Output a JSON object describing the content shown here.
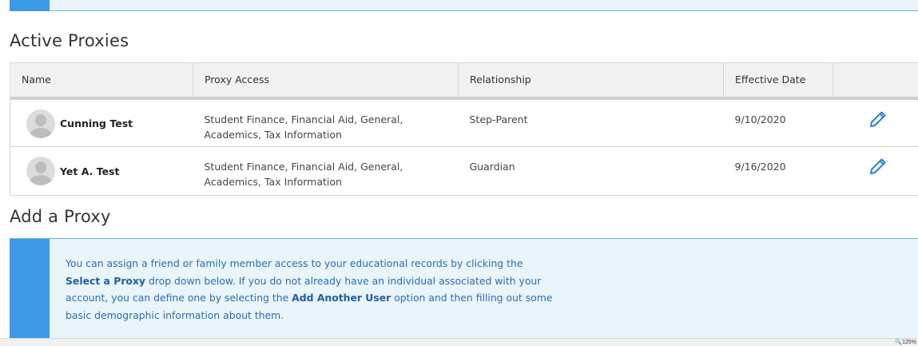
{
  "colors": {
    "accent": "#3d9ae6",
    "info_bg": "#e9f4fb",
    "info_text": "#2a6fae",
    "edit_icon": "#2b7fe0"
  },
  "active_proxies": {
    "title": "Active Proxies",
    "columns": [
      "Name",
      "Proxy Access",
      "Relationship",
      "Effective Date",
      ""
    ],
    "rows": [
      {
        "name": "Cunning Test",
        "access_line1": "Student Finance, Financial Aid, General,",
        "access_line2": "Academics, Tax Information",
        "relationship": "Step-Parent",
        "effective_date": "9/10/2020",
        "avatar_icon": "user-avatar-icon",
        "edit_icon": "pencil-icon"
      },
      {
        "name": "Yet A. Test",
        "access_line1": "Student Finance, Financial Aid, General,",
        "access_line2": "Academics, Tax Information",
        "relationship": "Guardian",
        "effective_date": "9/16/2020",
        "avatar_icon": "user-avatar-icon",
        "edit_icon": "pencil-icon"
      }
    ]
  },
  "add_proxy": {
    "title": "Add a Proxy",
    "info": {
      "t1": "You can assign a friend or family member access to your educational records by clicking the",
      "b1": "Select a Proxy",
      "t2": " drop down below. If you do not already have an individual associated with your account, you can define one by selecting the ",
      "b2": "Add Another User",
      "t3": " option and then filling out some basic demographic information about them."
    }
  },
  "status_bar": {
    "zoom": "125%",
    "zoom_icon": "zoom-icon"
  }
}
